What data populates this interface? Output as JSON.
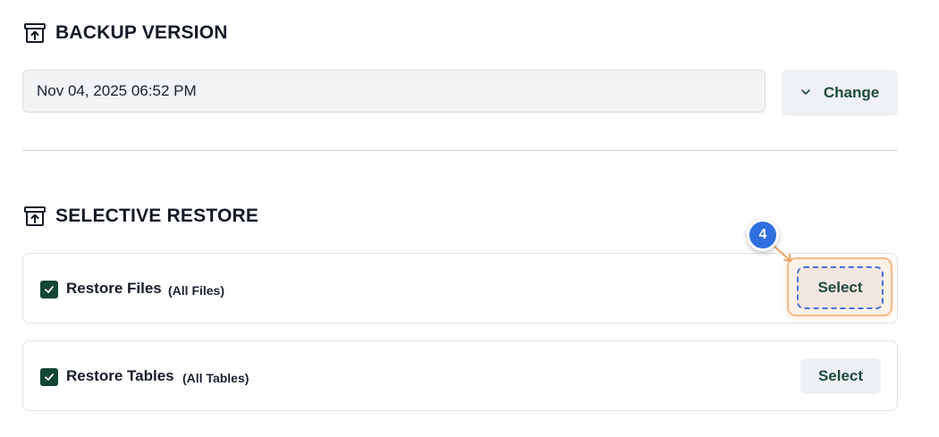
{
  "backup_version": {
    "heading": "BACKUP VERSION",
    "heading_icon": "archive-restore-icon",
    "selected_value": "Nov 04, 2025 06:52 PM",
    "change_button_label": "Change",
    "change_button_icon": "chevron-down-icon"
  },
  "selective_restore": {
    "heading": "SELECTIVE RESTORE",
    "heading_icon": "archive-restore-icon",
    "items": [
      {
        "label": "Restore Files",
        "scope": "(All Files)",
        "checked": true,
        "button_label": "Select"
      },
      {
        "label": "Restore Tables",
        "scope": "(All Tables)",
        "checked": true,
        "button_label": "Select"
      }
    ]
  },
  "tutorial": {
    "step_number": "4",
    "badge_color": "#2f6fe0",
    "highlight_color": "#f4b98a"
  },
  "colors": {
    "accent_green": "#124635",
    "button_text": "#1e4a3c",
    "field_bg": "#f1f3f5"
  }
}
